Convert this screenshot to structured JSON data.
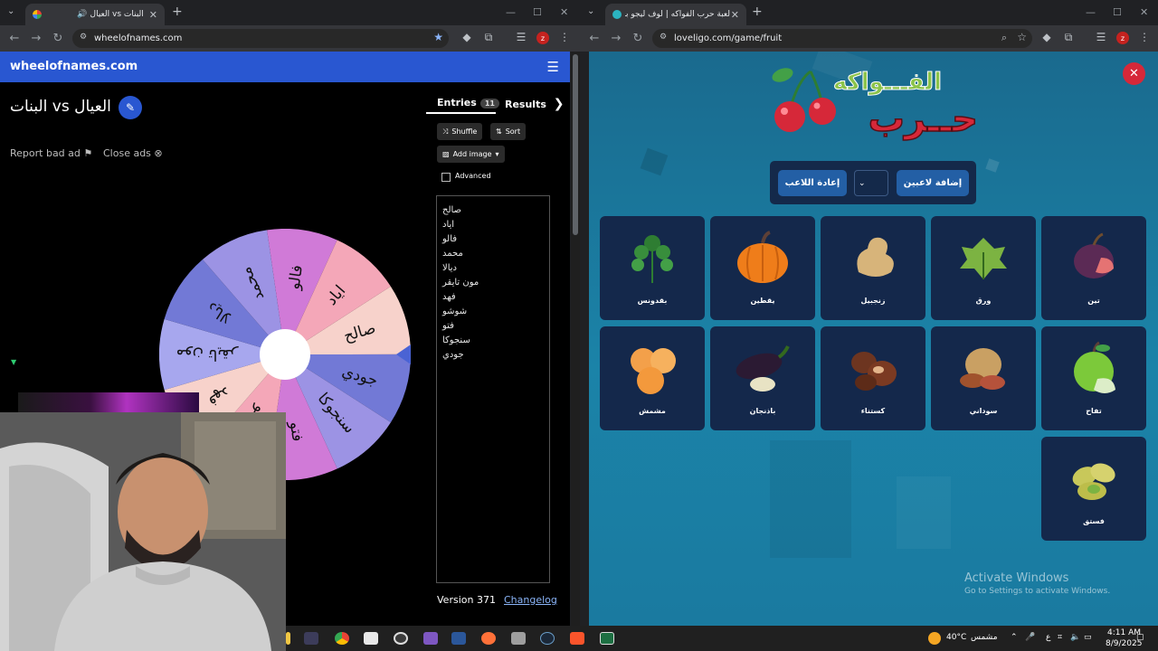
{
  "left_window": {
    "tab_title": "العيال vs البنات",
    "url": "wheelofnames.com",
    "site_title": "wheelofnames.com",
    "wheel_title": "البنات vs العيال",
    "report_ad": "Report bad ad",
    "close_ads": "Close ads",
    "tabs": {
      "entries": "Entries",
      "entries_count": "11",
      "results": "Results"
    },
    "buttons": {
      "shuffle": "Shuffle",
      "sort": "Sort",
      "add_image": "Add image",
      "advanced": "Advanced"
    },
    "entries": [
      "صالح",
      "اياد",
      "فالو",
      "محمد",
      "ديالا",
      "مون تايقر",
      "فهد",
      "شوشو",
      "فتو",
      "سنجوكا",
      "جودي"
    ],
    "wheel_slices": [
      "صالح",
      "جودي",
      "سنجوكا",
      "فتو",
      "شوشو",
      "فهد",
      "مون تايقر",
      "ديالا",
      "محمد",
      "فالو",
      "اياد"
    ],
    "wheel_colors": [
      "#f7d2cb",
      "#7279d6",
      "#9c93e4",
      "#d07ad7",
      "#f4a7b8",
      "#f7d2cb",
      "#a7a7ee",
      "#7279d6",
      "#9c93e4",
      "#d07ad7",
      "#f4a7b8"
    ],
    "version": "Version 371",
    "changelog": "Changelog"
  },
  "right_window": {
    "tab_title": "لعبة حرب الفواكه | لوف ليجو بوت",
    "url": "loveligo.com/game/fruit",
    "logo_top": "الفـــواكه",
    "logo_bottom": "حــرب",
    "buttons": {
      "add_players": "إضافة لاعبين",
      "reset_player": "إعادة اللاعب",
      "dropdown": "⌄"
    },
    "cards": [
      {
        "name": "تين",
        "icon": "fig-icon"
      },
      {
        "name": "ورق",
        "icon": "grape-leaf-icon"
      },
      {
        "name": "زنجبيل",
        "icon": "ginger-icon"
      },
      {
        "name": "يقطين",
        "icon": "pumpkin-icon"
      },
      {
        "name": "بقدونس",
        "icon": "parsley-icon"
      },
      {
        "name": "تفاح",
        "icon": "apple-icon"
      },
      {
        "name": "سوداني",
        "icon": "peanut-icon"
      },
      {
        "name": "كستناء",
        "icon": "chestnut-icon"
      },
      {
        "name": "باذنجان",
        "icon": "eggplant-icon"
      },
      {
        "name": "مشمش",
        "icon": "apricot-icon"
      },
      {
        "name": "فستق",
        "icon": "pistachio-icon"
      }
    ],
    "watermark_title": "Activate Windows",
    "watermark_sub": "Go to Settings to activate Windows."
  },
  "taskbar": {
    "weather_temp": "40°C",
    "weather_text": "مشمس",
    "lang": "ع",
    "time": "4:11 AM",
    "date": "8/9/2025"
  }
}
